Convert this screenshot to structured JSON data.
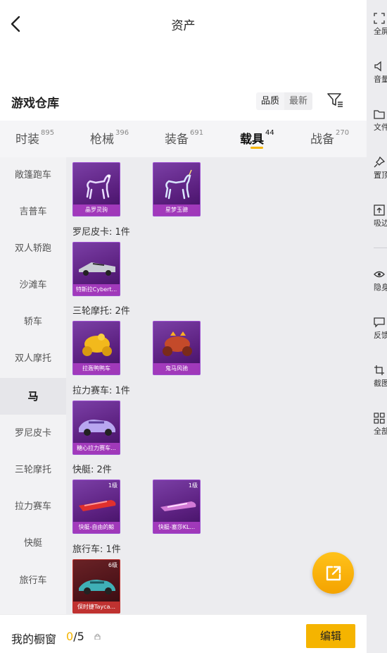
{
  "header": {
    "title": "资产"
  },
  "warehouse": {
    "title": "游戏仓库",
    "sort_options": [
      "品质",
      "最新"
    ]
  },
  "tabs": [
    {
      "label": "时装",
      "count": "895"
    },
    {
      "label": "枪械",
      "count": "396"
    },
    {
      "label": "装备",
      "count": "691"
    },
    {
      "label": "载具",
      "count": "44"
    },
    {
      "label": "战备",
      "count": "270"
    }
  ],
  "categories": [
    "敞篷跑车",
    "吉普车",
    "双人轿跑",
    "沙滩车",
    "轿车",
    "双人摩托",
    "马",
    "罗尼皮卡",
    "三轮摩托",
    "拉力赛车",
    "快艇",
    "旅行车"
  ],
  "sections": {
    "pickup": "罗尼皮卡: 1件",
    "trike": "三轮摩托: 2件",
    "rally": "拉力赛车: 1件",
    "boat": "快艇: 2件",
    "travel": "旅行车: 1件"
  },
  "items": {
    "horse1": {
      "name": "晶罗灵驹"
    },
    "horse2": {
      "name": "星梦玉骢"
    },
    "pickup1": {
      "name": "特斯拉Cybert..."
    },
    "trike1": {
      "name": "拉轰鸭鸭车"
    },
    "trike2": {
      "name": "鬼马风驰"
    },
    "rally1": {
      "name": "糖心拉力赛车..."
    },
    "boat1": {
      "name": "快艇-自由的鲸",
      "level": "1级"
    },
    "boat2": {
      "name": "快艇-塞莎KL...",
      "level": "1级"
    },
    "travel1": {
      "name": "保时捷Tayca...",
      "level": "6级"
    }
  },
  "bottom": {
    "label": "我的橱窗",
    "current": "0",
    "total": "/5",
    "edit": "编辑"
  },
  "side_menu": [
    "全屏",
    "音量",
    "文件",
    "置顶",
    "吸边",
    "隐身",
    "反馈",
    "截图",
    "全部"
  ],
  "colors": {
    "accent": "#f5b400",
    "card_purple": "#7b3fa6",
    "card_red": "#c2322f"
  }
}
